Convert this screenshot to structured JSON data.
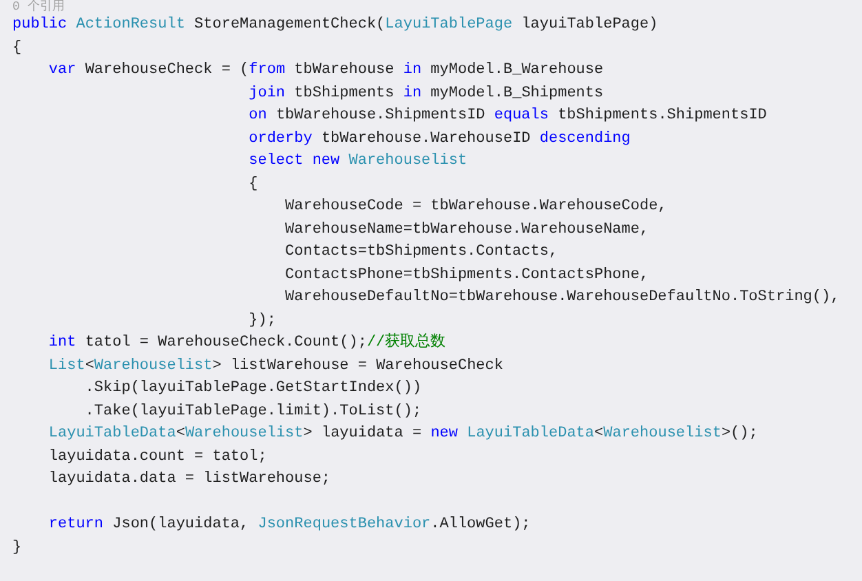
{
  "codelens": "0 个引用",
  "lines": [
    {
      "tokens": [
        {
          "kind": "kw",
          "text": "public "
        },
        {
          "kind": "type",
          "text": "ActionResult"
        },
        {
          "kind": "plain",
          "text": " StoreManagementCheck("
        },
        {
          "kind": "type",
          "text": "LayuiTablePage"
        },
        {
          "kind": "plain",
          "text": " layuiTablePage)"
        }
      ]
    },
    {
      "tokens": [
        {
          "kind": "plain",
          "text": "{"
        }
      ]
    },
    {
      "tokens": [
        {
          "kind": "kw",
          "text": "    var"
        },
        {
          "kind": "plain",
          "text": " WarehouseCheck = ("
        },
        {
          "kind": "kw",
          "text": "from"
        },
        {
          "kind": "plain",
          "text": " tbWarehouse "
        },
        {
          "kind": "kw",
          "text": "in"
        },
        {
          "kind": "plain",
          "text": " myModel.B_Warehouse"
        }
      ]
    },
    {
      "tokens": [
        {
          "kind": "kw",
          "text": "                          join"
        },
        {
          "kind": "plain",
          "text": " tbShipments "
        },
        {
          "kind": "kw",
          "text": "in"
        },
        {
          "kind": "plain",
          "text": " myModel.B_Shipments"
        }
      ]
    },
    {
      "tokens": [
        {
          "kind": "kw",
          "text": "                          on"
        },
        {
          "kind": "plain",
          "text": " tbWarehouse.ShipmentsID "
        },
        {
          "kind": "kw",
          "text": "equals"
        },
        {
          "kind": "plain",
          "text": " tbShipments.ShipmentsID"
        }
      ]
    },
    {
      "tokens": [
        {
          "kind": "kw",
          "text": "                          orderby"
        },
        {
          "kind": "plain",
          "text": " tbWarehouse.WarehouseID "
        },
        {
          "kind": "kw",
          "text": "descending"
        }
      ]
    },
    {
      "tokens": [
        {
          "kind": "kw",
          "text": "                          select new "
        },
        {
          "kind": "type",
          "text": "Warehouselist"
        }
      ]
    },
    {
      "tokens": [
        {
          "kind": "plain",
          "text": "                          {"
        }
      ]
    },
    {
      "tokens": [
        {
          "kind": "plain",
          "text": "                              WarehouseCode = tbWarehouse.WarehouseCode,"
        }
      ]
    },
    {
      "tokens": [
        {
          "kind": "plain",
          "text": "                              WarehouseName=tbWarehouse.WarehouseName,"
        }
      ]
    },
    {
      "tokens": [
        {
          "kind": "plain",
          "text": "                              Contacts=tbShipments.Contacts,"
        }
      ]
    },
    {
      "tokens": [
        {
          "kind": "plain",
          "text": "                              ContactsPhone=tbShipments.ContactsPhone,"
        }
      ]
    },
    {
      "tokens": [
        {
          "kind": "plain",
          "text": "                              WarehouseDefaultNo=tbWarehouse.WarehouseDefaultNo.ToString(),"
        }
      ]
    },
    {
      "tokens": [
        {
          "kind": "plain",
          "text": "                          });"
        }
      ]
    },
    {
      "tokens": [
        {
          "kind": "kw",
          "text": "    int"
        },
        {
          "kind": "plain",
          "text": " tatol = WarehouseCheck.Count();"
        },
        {
          "kind": "comment",
          "text": "//获取总数"
        }
      ]
    },
    {
      "tokens": [
        {
          "kind": "type",
          "text": "    List"
        },
        {
          "kind": "plain",
          "text": "<"
        },
        {
          "kind": "type",
          "text": "Warehouselist"
        },
        {
          "kind": "plain",
          "text": "> listWarehouse = WarehouseCheck"
        }
      ]
    },
    {
      "tokens": [
        {
          "kind": "plain",
          "text": "        .Skip(layuiTablePage.GetStartIndex())"
        }
      ]
    },
    {
      "tokens": [
        {
          "kind": "plain",
          "text": "        .Take(layuiTablePage.limit).ToList();"
        }
      ]
    },
    {
      "tokens": [
        {
          "kind": "type",
          "text": "    LayuiTableData"
        },
        {
          "kind": "plain",
          "text": "<"
        },
        {
          "kind": "type",
          "text": "Warehouselist"
        },
        {
          "kind": "plain",
          "text": "> layuidata = "
        },
        {
          "kind": "kw",
          "text": "new "
        },
        {
          "kind": "type",
          "text": "LayuiTableData"
        },
        {
          "kind": "plain",
          "text": "<"
        },
        {
          "kind": "type",
          "text": "Warehouselist"
        },
        {
          "kind": "plain",
          "text": ">();"
        }
      ]
    },
    {
      "tokens": [
        {
          "kind": "plain",
          "text": "    layuidata.count = tatol;"
        }
      ]
    },
    {
      "tokens": [
        {
          "kind": "plain",
          "text": "    layuidata.data = listWarehouse;"
        }
      ]
    },
    {
      "kind": "blank"
    },
    {
      "tokens": [
        {
          "kind": "kw",
          "text": "    return"
        },
        {
          "kind": "plain",
          "text": " Json(layuidata, "
        },
        {
          "kind": "type",
          "text": "JsonRequestBehavior"
        },
        {
          "kind": "plain",
          "text": ".AllowGet);"
        }
      ]
    },
    {
      "tokens": [
        {
          "kind": "plain",
          "text": "}"
        }
      ]
    }
  ]
}
